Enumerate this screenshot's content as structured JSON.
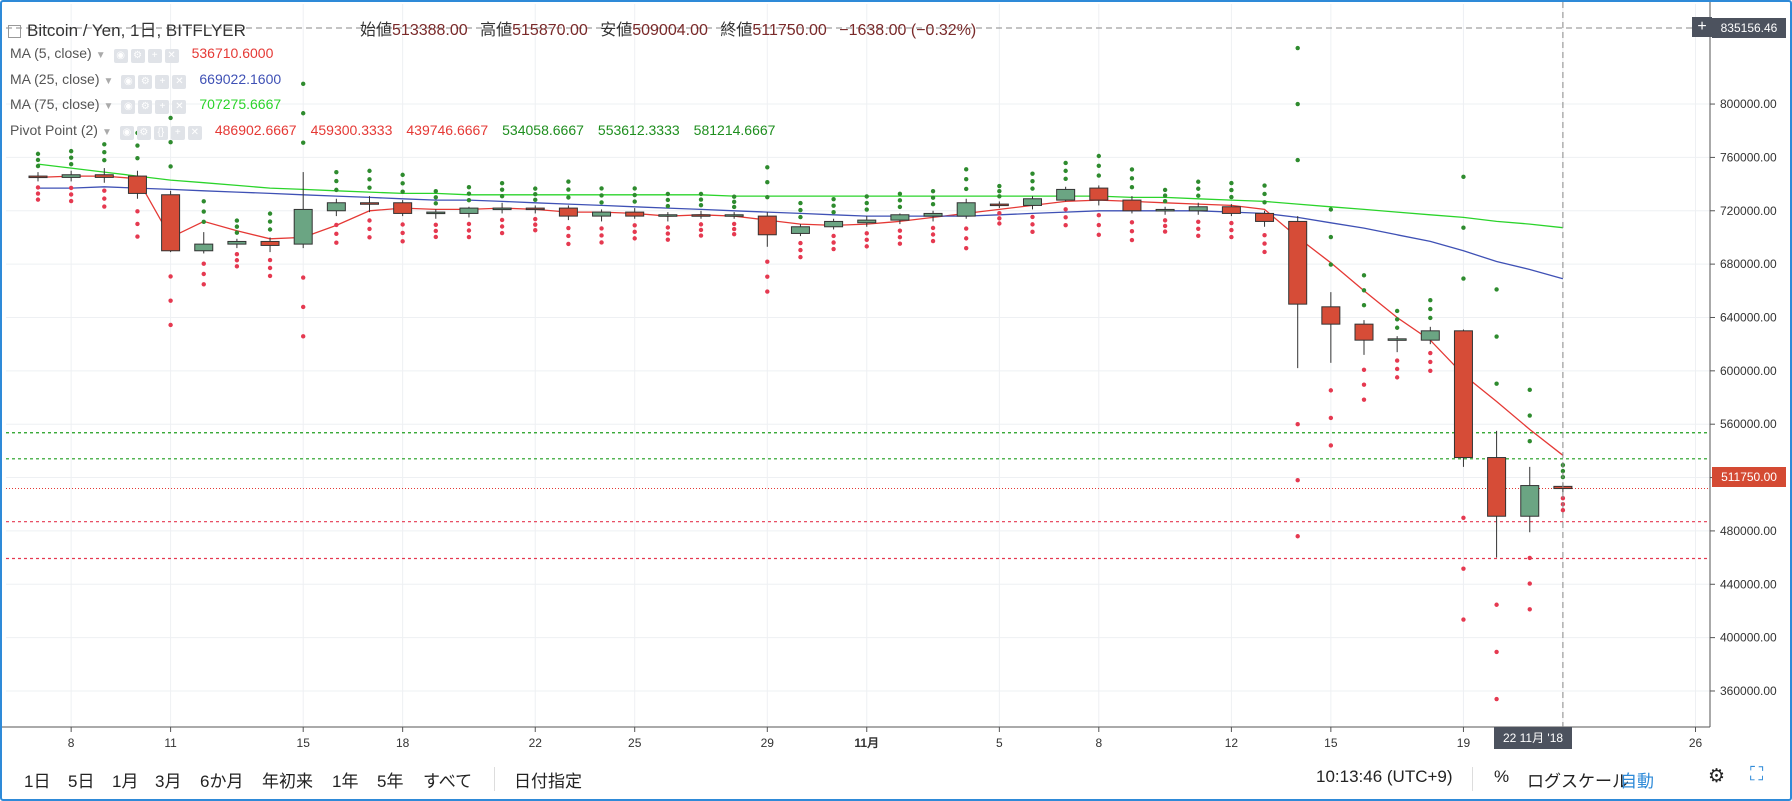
{
  "header": {
    "symbol": "Bitcoin / Yen, 1日, BITFLYER",
    "ohlc": [
      {
        "label": "始値",
        "value": "513388.00"
      },
      {
        "label": "高値",
        "value": "515870.00"
      },
      {
        "label": "安値",
        "value": "509004.00"
      },
      {
        "label": "終値",
        "value": "511750.00"
      }
    ],
    "change": "−1638.00 (−0.32%)"
  },
  "indicators": [
    {
      "name": "MA (5, close)",
      "values": [
        "536710.6000"
      ],
      "colors": [
        "#e53935"
      ]
    },
    {
      "name": "MA (25, close)",
      "values": [
        "669022.1600"
      ],
      "colors": [
        "#3f51b5"
      ]
    },
    {
      "name": "MA (75, close)",
      "values": [
        "707275.6667"
      ],
      "colors": [
        "#2bd42b"
      ]
    },
    {
      "name": "Pivot Point (2)",
      "values": [
        "486902.6667",
        "459300.3333",
        "439746.6667",
        "534058.6667",
        "553612.3333",
        "581214.6667"
      ],
      "colors": [
        "#e53935",
        "#e53935",
        "#e53935",
        "#1e8e1e",
        "#1e8e1e",
        "#1e8e1e"
      ]
    }
  ],
  "price_axis": {
    "last_price": "511750.00",
    "crosshair_price": "835156.46",
    "crosshair_date": "22 11月 '18"
  },
  "bottom_bar": {
    "timeframes": [
      "1日",
      "5日",
      "1月",
      "3月",
      "6か月",
      "年初来",
      "1年",
      "5年",
      "すべて"
    ],
    "date_range": "日付指定",
    "clock": "10:13:46 (UTC+9)",
    "percent": "%",
    "log_scale": "ログスケール",
    "auto": "自動"
  },
  "colors": {
    "up": "#6ba583",
    "down": "#d64c37",
    "ma5": "#e53935",
    "ma25": "#3f51b5",
    "ma75": "#2bd42b",
    "pivot_support": "#e53950",
    "pivot_resistance": "#2e8b2e",
    "accent": "#2e8ad8"
  },
  "chart_data": {
    "type": "candlestick",
    "title": "Bitcoin / Yen, 1日, BITFLYER",
    "ylim": [
      333000,
      875000
    ],
    "y_ticks": [
      360000,
      400000,
      440000,
      480000,
      520000,
      560000,
      600000,
      640000,
      680000,
      720000,
      760000,
      800000
    ],
    "y_tick_labels": [
      "360000.00",
      "400000.00",
      "440000.00",
      "480000.00",
      "520000.00",
      "560000.00",
      "600000.00",
      "640000.00",
      "680000.00",
      "720000.00",
      "760000.00",
      "800000.00"
    ],
    "x_ticks": [
      {
        "i": 1,
        "label": "8"
      },
      {
        "i": 4,
        "label": "11"
      },
      {
        "i": 8,
        "label": "15"
      },
      {
        "i": 11,
        "label": "18"
      },
      {
        "i": 15,
        "label": "22"
      },
      {
        "i": 18,
        "label": "25"
      },
      {
        "i": 22,
        "label": "29"
      },
      {
        "i": 25,
        "label": "11月"
      },
      {
        "i": 29,
        "label": "5"
      },
      {
        "i": 32,
        "label": "8"
      },
      {
        "i": 36,
        "label": "12"
      },
      {
        "i": 39,
        "label": "15"
      },
      {
        "i": 43,
        "label": "19"
      },
      {
        "i": 46,
        "label": "22"
      },
      {
        "i": 50,
        "label": "26"
      }
    ],
    "candles": [
      {
        "o": 746000,
        "h": 749000,
        "l": 742000,
        "c": 745000
      },
      {
        "o": 745000,
        "h": 750000,
        "l": 742000,
        "c": 747000
      },
      {
        "o": 747000,
        "h": 752000,
        "l": 741000,
        "c": 745000
      },
      {
        "o": 746000,
        "h": 750000,
        "l": 729000,
        "c": 733000
      },
      {
        "o": 732000,
        "h": 735000,
        "l": 689000,
        "c": 690000
      },
      {
        "o": 690000,
        "h": 704000,
        "l": 688000,
        "c": 695000
      },
      {
        "o": 695000,
        "h": 699000,
        "l": 692000,
        "c": 697000
      },
      {
        "o": 697000,
        "h": 700000,
        "l": 689000,
        "c": 694000
      },
      {
        "o": 695000,
        "h": 749000,
        "l": 692000,
        "c": 721000
      },
      {
        "o": 720000,
        "h": 729000,
        "l": 716000,
        "c": 726000
      },
      {
        "o": 726000,
        "h": 731000,
        "l": 719000,
        "c": 725000
      },
      {
        "o": 726000,
        "h": 728000,
        "l": 716000,
        "c": 718000
      },
      {
        "o": 718000,
        "h": 721000,
        "l": 714000,
        "c": 719000
      },
      {
        "o": 718000,
        "h": 723000,
        "l": 715000,
        "c": 722000
      },
      {
        "o": 721000,
        "h": 726000,
        "l": 718000,
        "c": 722000
      },
      {
        "o": 722000,
        "h": 724000,
        "l": 718000,
        "c": 721000
      },
      {
        "o": 722000,
        "h": 724000,
        "l": 713000,
        "c": 716000
      },
      {
        "o": 716000,
        "h": 721000,
        "l": 712000,
        "c": 719000
      },
      {
        "o": 719000,
        "h": 722000,
        "l": 714000,
        "c": 716000
      },
      {
        "o": 716000,
        "h": 719000,
        "l": 712000,
        "c": 717000
      },
      {
        "o": 717000,
        "h": 720000,
        "l": 714000,
        "c": 716000
      },
      {
        "o": 716000,
        "h": 719000,
        "l": 714000,
        "c": 717000
      },
      {
        "o": 716000,
        "h": 719000,
        "l": 693000,
        "c": 702000
      },
      {
        "o": 703000,
        "h": 710000,
        "l": 701000,
        "c": 708000
      },
      {
        "o": 708000,
        "h": 714000,
        "l": 706000,
        "c": 712000
      },
      {
        "o": 711000,
        "h": 716000,
        "l": 708000,
        "c": 713000
      },
      {
        "o": 713000,
        "h": 718000,
        "l": 710000,
        "c": 717000
      },
      {
        "o": 716000,
        "h": 720000,
        "l": 712000,
        "c": 718000
      },
      {
        "o": 716000,
        "h": 729000,
        "l": 714000,
        "c": 726000
      },
      {
        "o": 725000,
        "h": 727000,
        "l": 722000,
        "c": 724000
      },
      {
        "o": 724000,
        "h": 731000,
        "l": 721000,
        "c": 729000
      },
      {
        "o": 728000,
        "h": 738000,
        "l": 727000,
        "c": 736000
      },
      {
        "o": 737000,
        "h": 739000,
        "l": 724000,
        "c": 728000
      },
      {
        "o": 728000,
        "h": 731000,
        "l": 718000,
        "c": 720000
      },
      {
        "o": 720000,
        "h": 723000,
        "l": 717000,
        "c": 721000
      },
      {
        "o": 720000,
        "h": 726000,
        "l": 717000,
        "c": 723000
      },
      {
        "o": 723000,
        "h": 725000,
        "l": 716000,
        "c": 718000
      },
      {
        "o": 718000,
        "h": 720000,
        "l": 708000,
        "c": 712000
      },
      {
        "o": 712000,
        "h": 716000,
        "l": 602000,
        "c": 650000
      },
      {
        "o": 648000,
        "h": 659000,
        "l": 606000,
        "c": 635000
      },
      {
        "o": 635000,
        "h": 638000,
        "l": 612000,
        "c": 623000
      },
      {
        "o": 623000,
        "h": 626000,
        "l": 614000,
        "c": 624000
      },
      {
        "o": 623000,
        "h": 633000,
        "l": 620000,
        "c": 630000
      },
      {
        "o": 630000,
        "h": 631000,
        "l": 528000,
        "c": 535000
      },
      {
        "o": 535000,
        "h": 555000,
        "l": 460000,
        "c": 491000
      },
      {
        "o": 491000,
        "h": 528000,
        "l": 479000,
        "c": 514000
      },
      {
        "o": 513388,
        "h": 515870,
        "l": 509004,
        "c": 511750
      }
    ],
    "series": [
      {
        "name": "MA (5, close)",
        "values": [
          745000,
          746000,
          746000,
          744000,
          700000,
          712000,
          705000,
          699000,
          700000,
          709000,
          720000,
          722000,
          721000,
          721000,
          722000,
          721000,
          719000,
          719000,
          718000,
          716000,
          717000,
          716000,
          713000,
          710000,
          709000,
          710000,
          712000,
          715000,
          718000,
          721000,
          724000,
          727000,
          728000,
          727000,
          726000,
          725000,
          724000,
          721000,
          700000,
          681000,
          660000,
          640000,
          623000,
          597000,
          577000,
          556000,
          536710
        ]
      },
      {
        "name": "MA (25, close)",
        "values": [
          737000,
          737000,
          738000,
          737000,
          736000,
          735000,
          734000,
          733000,
          732000,
          731000,
          730000,
          729000,
          728000,
          728000,
          727000,
          726000,
          725000,
          724000,
          723000,
          722000,
          721000,
          720000,
          719000,
          718000,
          717000,
          716000,
          716000,
          716000,
          716000,
          717000,
          718000,
          719000,
          720000,
          720000,
          720000,
          720000,
          719000,
          718000,
          715000,
          711000,
          707000,
          702000,
          697000,
          690000,
          682000,
          676000,
          669022
        ]
      },
      {
        "name": "MA (75, close)",
        "values": [
          755000,
          752000,
          749000,
          746000,
          743000,
          741000,
          739000,
          737000,
          736000,
          735000,
          734000,
          733000,
          733000,
          732000,
          732000,
          732000,
          732000,
          732000,
          732000,
          732000,
          732000,
          731000,
          731000,
          731000,
          731000,
          731000,
          731000,
          731000,
          731000,
          731000,
          731000,
          731000,
          731000,
          730000,
          730000,
          729000,
          728000,
          727000,
          725000,
          723000,
          721000,
          719000,
          717000,
          715000,
          712000,
          710000,
          707275
        ]
      }
    ],
    "pivot_levels": [
      {
        "value": 553612.3333,
        "kind": "resistance"
      },
      {
        "value": 534058.6667,
        "kind": "resistance"
      },
      {
        "value": 486902.6667,
        "kind": "support"
      },
      {
        "value": 459300.3333,
        "kind": "support"
      }
    ],
    "last_price_line": 511750
  }
}
